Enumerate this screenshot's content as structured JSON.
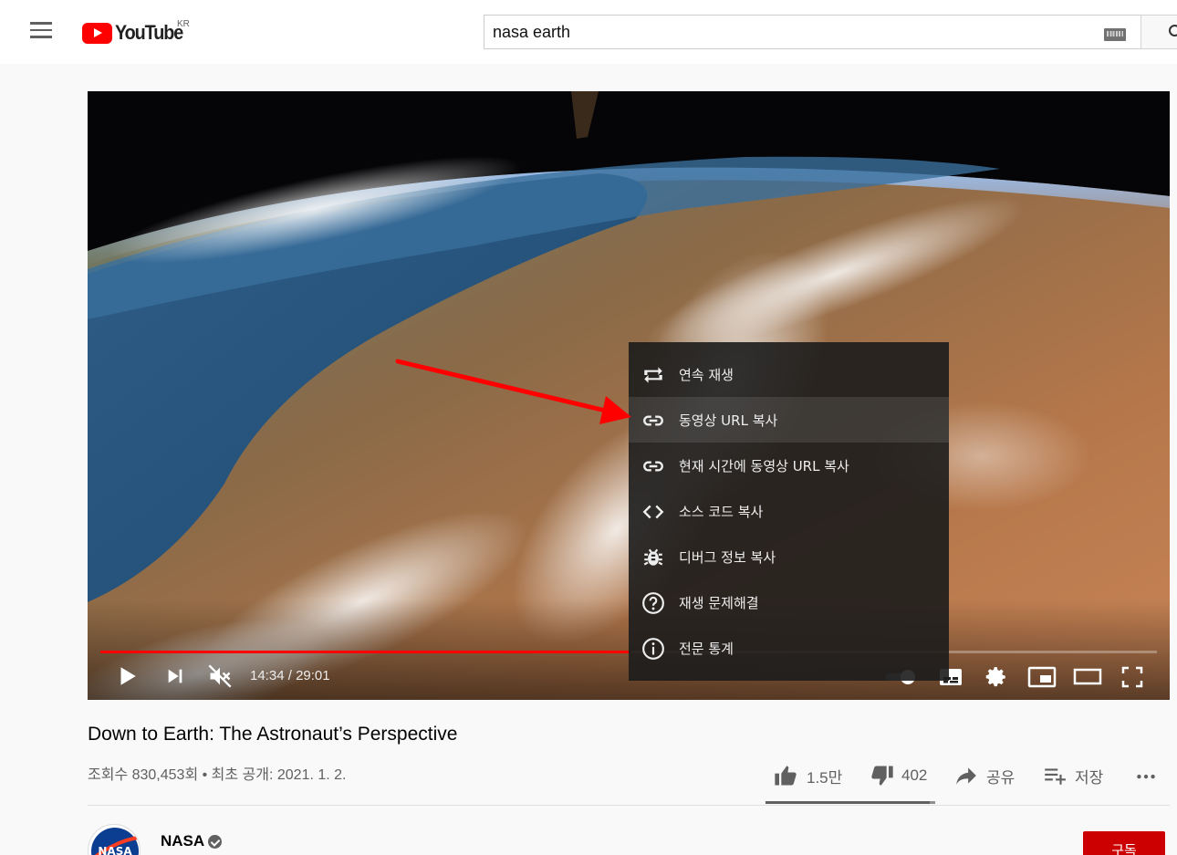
{
  "masthead": {
    "logo_text": "YouTube",
    "country_code": "KR",
    "search_query": "nasa earth",
    "icons": [
      "menu-icon",
      "youtube-logo",
      "keyboard-icon",
      "search-icon"
    ]
  },
  "player": {
    "time_current": "14:34",
    "time_separator": "/",
    "time_total": "29:01",
    "progress_fraction": 0.502,
    "muted": true,
    "icons": [
      "play-icon",
      "next-icon",
      "mute-icon",
      "autoplay-toggle",
      "subtitles-icon",
      "settings-icon",
      "miniplayer-icon",
      "theater-icon",
      "fullscreen-icon"
    ]
  },
  "context_menu": {
    "highlighted_index": 1,
    "items": [
      {
        "label": "연속 재생",
        "icon": "loop-icon"
      },
      {
        "label": "동영상 URL 복사",
        "icon": "link-icon"
      },
      {
        "label": "현재 시간에 동영상 URL 복사",
        "icon": "link-icon"
      },
      {
        "label": "소스 코드 복사",
        "icon": "code-icon"
      },
      {
        "label": "디버그 정보 복사",
        "icon": "bug-icon"
      },
      {
        "label": "재생 문제해결",
        "icon": "help-icon"
      },
      {
        "label": "전문 통계",
        "icon": "info-icon"
      }
    ]
  },
  "video": {
    "title": "Down to Earth: The Astronaut’s Perspective",
    "meta": "조회수 830,453회 • 최초 공개: 2021. 1. 2.",
    "actions": {
      "like_count": "1.5만",
      "dislike_count": "402",
      "share_label": "공유",
      "save_label": "저장",
      "like_ratio": 0.97
    }
  },
  "channel": {
    "name": "NASA",
    "avatar_text": "NASA",
    "subscribe_label": "구독"
  },
  "colors": {
    "brand_red": "#ff0000",
    "subscribe_red": "#cc0000",
    "annotation_arrow": "#ff0000"
  }
}
